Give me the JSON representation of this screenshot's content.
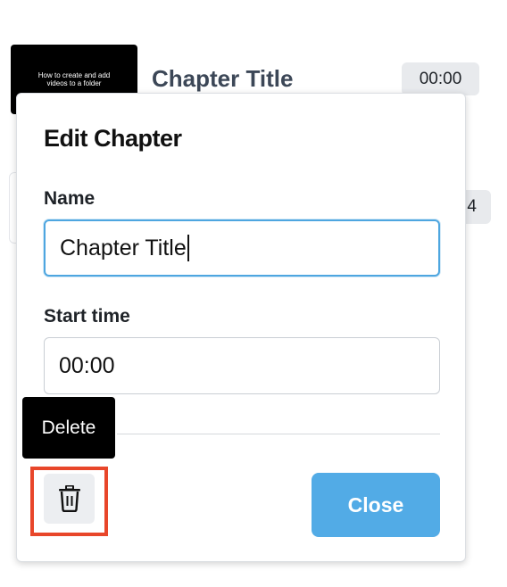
{
  "chapters": [
    {
      "thumbnail_text": "How to create and add videos to a folder",
      "title": "Chapter Title",
      "time": "00:00"
    },
    {
      "time_partial": "4"
    }
  ],
  "edit_chapter": {
    "title": "Edit Chapter",
    "name_label": "Name",
    "name_value": "Chapter Title",
    "start_time_label": "Start time",
    "start_time_value": "00:00",
    "delete_tooltip": "Delete",
    "delete_icon": "trash-icon",
    "close_label": "Close"
  },
  "colors": {
    "accent": "#52abe6",
    "focus_border": "#4ea6e0",
    "highlight": "#e8462a"
  }
}
